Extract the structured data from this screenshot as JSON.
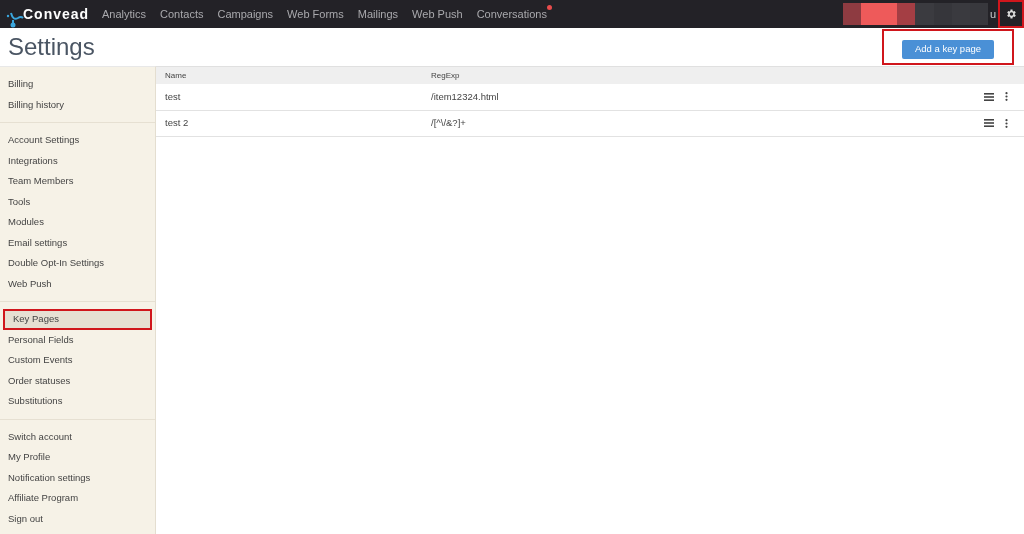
{
  "nav": {
    "logo": "Convead",
    "items": [
      {
        "label": "Analytics",
        "notification_dot": false
      },
      {
        "label": "Contacts",
        "notification_dot": false
      },
      {
        "label": "Campaigns",
        "notification_dot": false
      },
      {
        "label": "Web Forms",
        "notification_dot": false
      },
      {
        "label": "Mailings",
        "notification_dot": false
      },
      {
        "label": "Web Push",
        "notification_dot": false
      },
      {
        "label": "Conversations",
        "notification_dot": true
      }
    ],
    "account_fragment": "u",
    "settings_annotated": true
  },
  "page": {
    "title": "Settings",
    "add_button": {
      "label": "Add a key page",
      "annotated": true
    }
  },
  "sidebar": {
    "groups": [
      {
        "items": [
          {
            "label": "Billing",
            "selected": false,
            "annotated": false
          },
          {
            "label": "Billing history",
            "selected": false,
            "annotated": false
          }
        ]
      },
      {
        "items": [
          {
            "label": "Account Settings",
            "selected": false,
            "annotated": false
          },
          {
            "label": "Integrations",
            "selected": false,
            "annotated": false
          },
          {
            "label": "Team Members",
            "selected": false,
            "annotated": false
          },
          {
            "label": "Tools",
            "selected": false,
            "annotated": false
          },
          {
            "label": "Modules",
            "selected": false,
            "annotated": false
          },
          {
            "label": "Email settings",
            "selected": false,
            "annotated": false
          },
          {
            "label": "Double Opt-In Settings",
            "selected": false,
            "annotated": false
          },
          {
            "label": "Web Push",
            "selected": false,
            "annotated": false
          }
        ]
      },
      {
        "items": [
          {
            "label": "Key Pages",
            "selected": true,
            "annotated": true
          },
          {
            "label": "Personal Fields",
            "selected": false,
            "annotated": false
          },
          {
            "label": "Custom Events",
            "selected": false,
            "annotated": false
          },
          {
            "label": "Order statuses",
            "selected": false,
            "annotated": false
          },
          {
            "label": "Substitutions",
            "selected": false,
            "annotated": false
          }
        ]
      },
      {
        "items": [
          {
            "label": "Switch account",
            "selected": false,
            "annotated": false
          },
          {
            "label": "My Profile",
            "selected": false,
            "annotated": false
          },
          {
            "label": "Notification settings",
            "selected": false,
            "annotated": false
          },
          {
            "label": "Affiliate Program",
            "selected": false,
            "annotated": false
          },
          {
            "label": "Sign out",
            "selected": false,
            "annotated": false
          }
        ]
      }
    ]
  },
  "table": {
    "columns": [
      "Name",
      "RegExp"
    ],
    "rows": [
      {
        "name": "test",
        "regexp": "/item12324.html"
      },
      {
        "name": "test 2",
        "regexp": "/[^\\/&?]+"
      }
    ]
  }
}
